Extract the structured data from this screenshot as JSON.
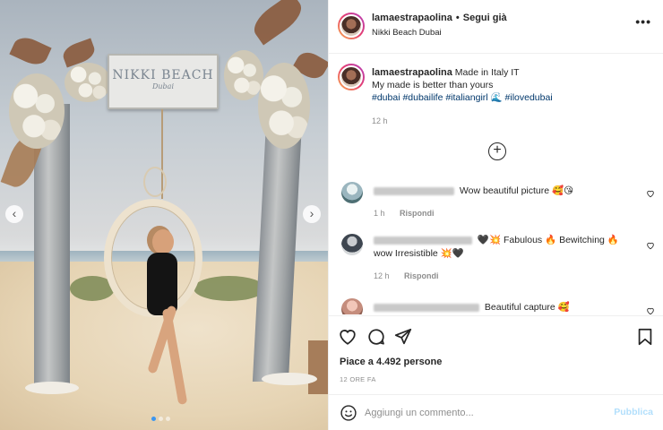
{
  "post": {
    "username": "lamaestrapaolina",
    "separator": "•",
    "follow_label": "Segui già",
    "location": "Nikki Beach Dubai",
    "more_icon": "more-horizontal-icon"
  },
  "photo": {
    "sign_title": "NIKKI BEACH",
    "sign_subtitle": "Dubai",
    "prev_icon": "chevron-left-icon",
    "next_icon": "chevron-right-icon",
    "slides_count": 3,
    "active_slide": 1
  },
  "caption": {
    "username": "lamaestrapaolina",
    "line1": "Made in Italy IT",
    "line2": "My made is better than yours",
    "hashtags": [
      "#dubai",
      "#dubailife",
      "#italiangirl",
      "🌊",
      "#ilovedubai"
    ],
    "time": "12 h"
  },
  "load_more_icon": "plus-circle-icon",
  "comments": [
    {
      "text": "Wow beautiful picture 🥰😘",
      "time": "1 h",
      "reply_label": "Rispondi"
    },
    {
      "text": "🖤💥 Fabulous 🔥 Bewitching 🔥 wow Irresistible 💥🖤",
      "time": "12 h",
      "reply_label": "Rispondi"
    },
    {
      "text": "Beautiful capture 🥰",
      "time": "",
      "reply_label": ""
    }
  ],
  "actions": {
    "like_icon": "heart-icon",
    "comment_icon": "comment-icon",
    "share_icon": "send-icon",
    "save_icon": "bookmark-icon",
    "likes_text": "Piace a 4.492 persone",
    "date_text": "12 ORE FA"
  },
  "composer": {
    "emoji_icon": "emoji-icon",
    "placeholder": "Aggiungi un commento...",
    "value": "",
    "publish_label": "Pubblica"
  },
  "colors": {
    "text": "#262626",
    "secondary": "#8e8e8e",
    "hashtag": "#00376b",
    "publish_disabled": "#b2dffc",
    "carousel_dot_active": "#3b96f0"
  }
}
